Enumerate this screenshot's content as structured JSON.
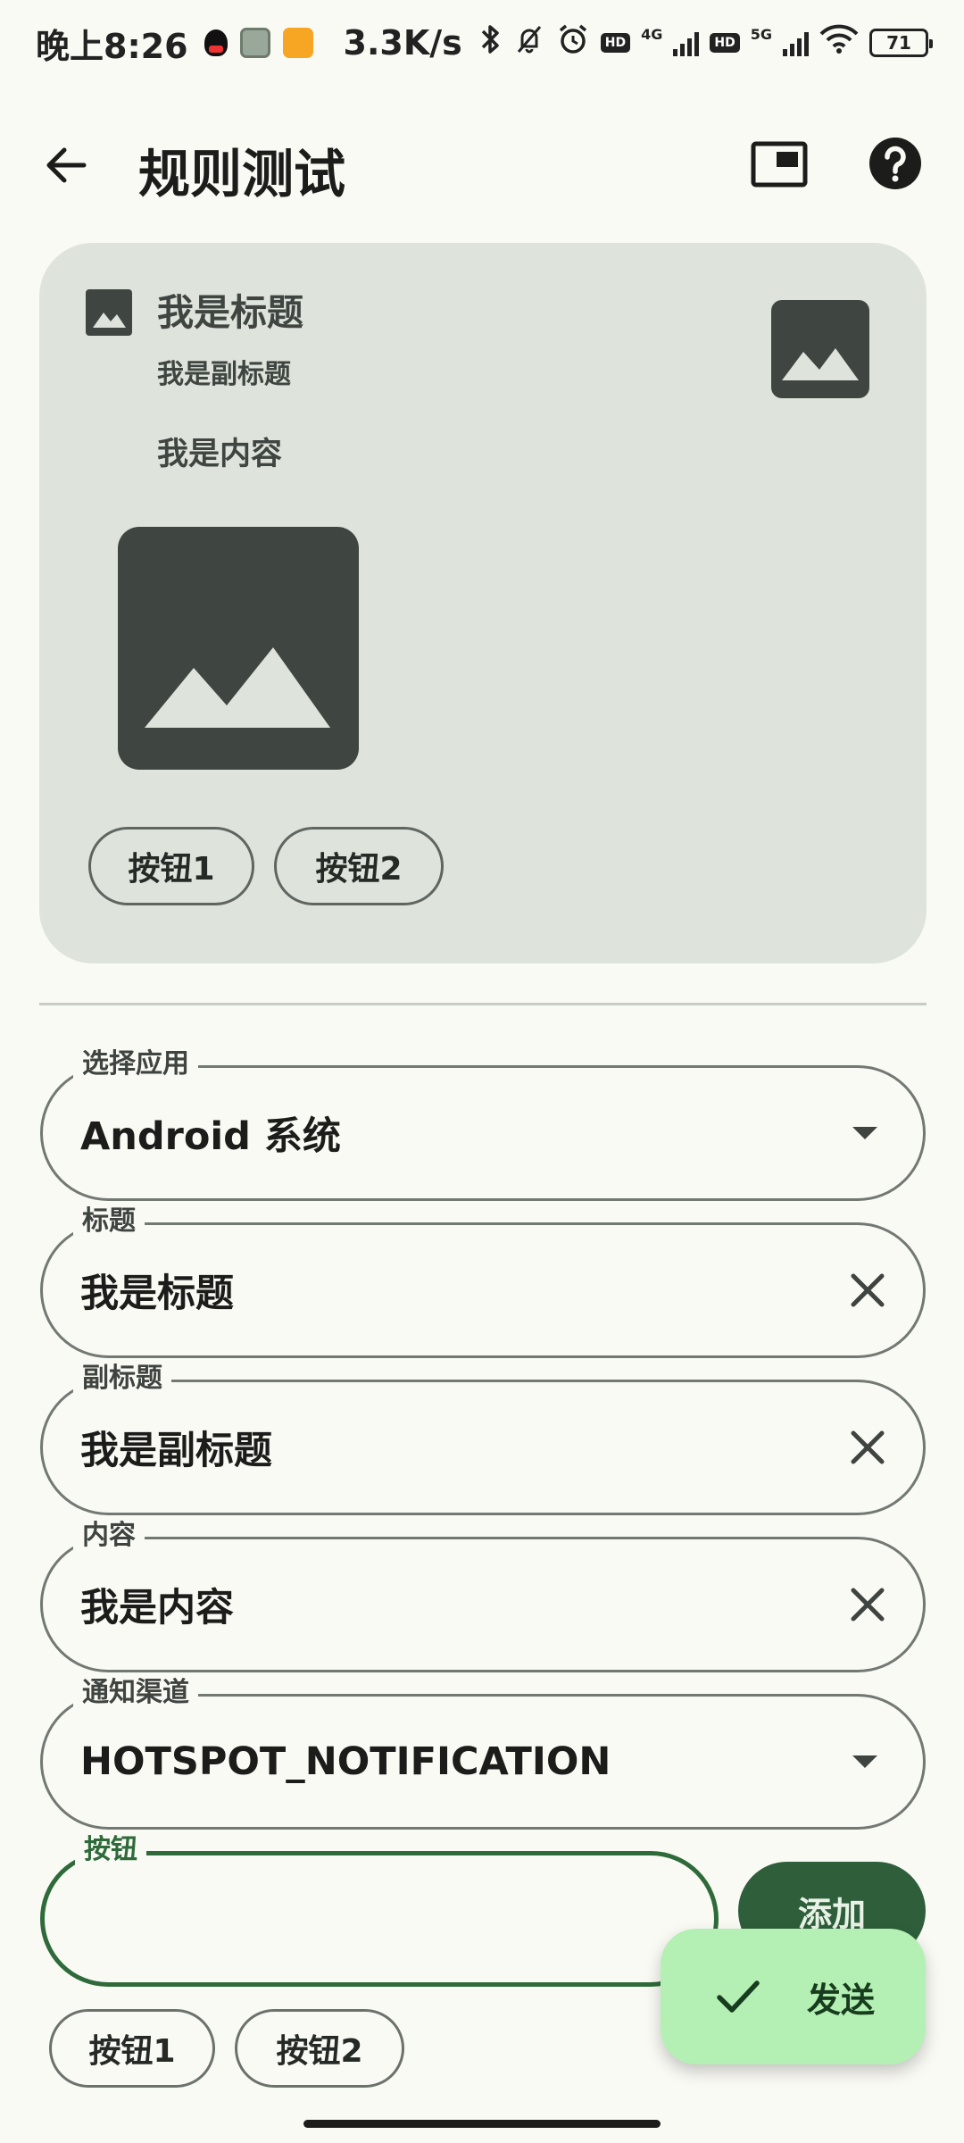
{
  "status_bar": {
    "time": "晚上8:26",
    "net_speed": "3.3K/s",
    "hd1": "HD",
    "net1": "4G",
    "hd2": "HD",
    "net2": "5G",
    "battery": "71"
  },
  "app_bar": {
    "title": "规则测试",
    "icons": [
      "back-arrow-icon",
      "picture-in-picture-icon",
      "help-icon"
    ]
  },
  "preview": {
    "title": "我是标题",
    "subtitle": "我是副标题",
    "content": "我是内容",
    "buttons": [
      "按钮1",
      "按钮2"
    ]
  },
  "form": {
    "app_select": {
      "label": "选择应用",
      "value": "Android 系统"
    },
    "title_field": {
      "label": "标题",
      "value": "我是标题"
    },
    "subtitle_field": {
      "label": "副标题",
      "value": "我是副标题"
    },
    "content_field": {
      "label": "内容",
      "value": "我是内容"
    },
    "channel_select": {
      "label": "通知渠道",
      "value": "HOTSPOT_NOTIFICATION"
    },
    "button_field": {
      "label": "按钮",
      "value": ""
    },
    "add_label": "添加",
    "chips": [
      "按钮1",
      "按钮2"
    ]
  },
  "fab": {
    "label": "发送",
    "icon": "check-icon"
  },
  "colors": {
    "background": "#fafaf5",
    "card": "#dee3dc",
    "primary": "#2e5e3a",
    "fab": "#b4f0b4"
  }
}
